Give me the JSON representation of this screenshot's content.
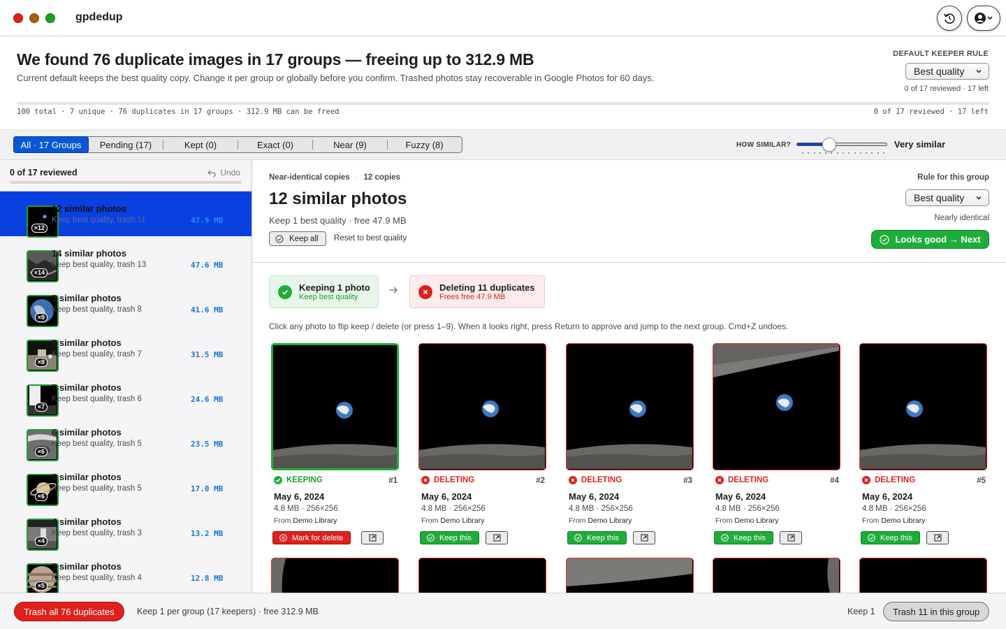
{
  "app": {
    "title": "gpdedup"
  },
  "header": {
    "title": "We found 76 duplicate images in 17 groups — freeing up to 312.9 MB",
    "subtitle": "Current default keeps the best quality copy. Change it per group or globally before you confirm. Trashed photos stay recoverable in Google Photos for 60 days.",
    "keeper_label": "DEFAULT KEEPER RULE",
    "keeper_value": "Best quality",
    "reviewed": "0 of 17 reviewed · 17 left",
    "progress": 0,
    "stats_left": "100 total · 7 unique · 76 duplicates in 17 groups · 312.9 MB can be freed",
    "stats_right": "0 of 17 reviewed · 17 left"
  },
  "filters": {
    "tabs": [
      {
        "label": "All · 17 Groups",
        "active": true
      },
      {
        "label": "Pending (17)"
      },
      {
        "label": "Kept (0)"
      },
      {
        "label": "Exact (0)"
      },
      {
        "label": "Near (9)"
      },
      {
        "label": "Fuzzy (8)"
      }
    ],
    "similarity_label": "HOW SIMILAR?",
    "similarity_value": "Very similar",
    "similarity_level": 0.3
  },
  "sidebar": {
    "reviewed": "0 of 17 reviewed",
    "undo": "Undo",
    "groups": [
      {
        "title": "12 similar photos",
        "sub": "Keep best quality, trash 11",
        "size": "47.9 MB",
        "badge": "×12",
        "thumb": "earth"
      },
      {
        "title": "14 similar photos",
        "sub": "Keep best quality, trash 13",
        "size": "47.6 MB",
        "badge": "×14",
        "thumb": "lunar"
      },
      {
        "title": "9 similar photos",
        "sub": "Keep best quality, trash 8",
        "size": "41.6 MB",
        "badge": "×9",
        "thumb": "globe"
      },
      {
        "title": "8 similar photos",
        "sub": "Keep best quality, trash 7",
        "size": "31.5 MB",
        "badge": "×8",
        "thumb": "rover"
      },
      {
        "title": "7 similar photos",
        "sub": "Keep best quality, trash 6",
        "size": "24.6 MB",
        "badge": "×7",
        "thumb": "station"
      },
      {
        "title": "6 similar photos",
        "sub": "Keep best quality, trash 5",
        "size": "23.5 MB",
        "badge": "×6",
        "thumb": "crater"
      },
      {
        "title": "6 similar photos",
        "sub": "Keep best quality, trash 5",
        "size": "17.0 MB",
        "badge": "×6",
        "thumb": "saturn"
      },
      {
        "title": "4 similar photos",
        "sub": "Keep best quality, trash 3",
        "size": "13.2 MB",
        "badge": "×4",
        "thumb": "moonwalk"
      },
      {
        "title": "5 similar photos",
        "sub": "Keep best quality, trash 4",
        "size": "12.8 MB",
        "badge": "×5",
        "thumb": "jupiter"
      }
    ]
  },
  "main": {
    "meta_kind": "Near-identical copies",
    "meta_count": "12 copies",
    "title": "12 similar photos",
    "subtitle": "Keep 1 best quality · free 47.9 MB",
    "keep_all": "Keep all",
    "reset": "Reset to best quality",
    "rule_label": "Rule for this group",
    "rule_value": "Best quality",
    "nearly": "Nearly identical",
    "next": "Looks good → Next",
    "summary_keep_title": "Keeping 1 photo",
    "summary_keep_sub": "Keep best quality",
    "summary_del_title": "Deleting 11 duplicates",
    "summary_del_sub": "Frees free 47.9 MB",
    "hint": "Click any photo to flip keep / delete (or press 1–9). When it looks right, press Return to approve and jump to the next group. Cmd+Z undoes.",
    "photos": [
      {
        "status": "KEEPING",
        "num": "#1",
        "date": "May 6, 2024",
        "meta": "4.8 MB · 256×256",
        "from": "From",
        "source": "Demo Library",
        "action": "Mark for delete"
      },
      {
        "status": "DELETING",
        "num": "#2",
        "date": "May 6, 2024",
        "meta": "4.8 MB · 256×256",
        "from": "From",
        "source": "Demo Library",
        "action": "Keep this"
      },
      {
        "status": "DELETING",
        "num": "#3",
        "date": "May 6, 2024",
        "meta": "4.8 MB · 256×256",
        "from": "From",
        "source": "Demo Library",
        "action": "Keep this"
      },
      {
        "status": "DELETING",
        "num": "#4",
        "date": "May 6, 2024",
        "meta": "4.8 MB · 256×256",
        "from": "From",
        "source": "Demo Library",
        "action": "Keep this"
      },
      {
        "status": "DELETING",
        "num": "#5",
        "date": "May 6, 2024",
        "meta": "4.8 MB · 256×256",
        "from": "From",
        "source": "Demo Library",
        "action": "Keep this"
      }
    ]
  },
  "footer": {
    "trash_all": "Trash all 76 duplicates",
    "info": "Keep 1 per group (17 keepers) · free 312.9 MB",
    "keep1": "Keep 1",
    "trash_group": "Trash 11 in this group"
  },
  "colors": {
    "accent": "#0a3fe0",
    "keep": "#1fad3a",
    "delete": "#e0201c",
    "size": "#1a73d9"
  }
}
